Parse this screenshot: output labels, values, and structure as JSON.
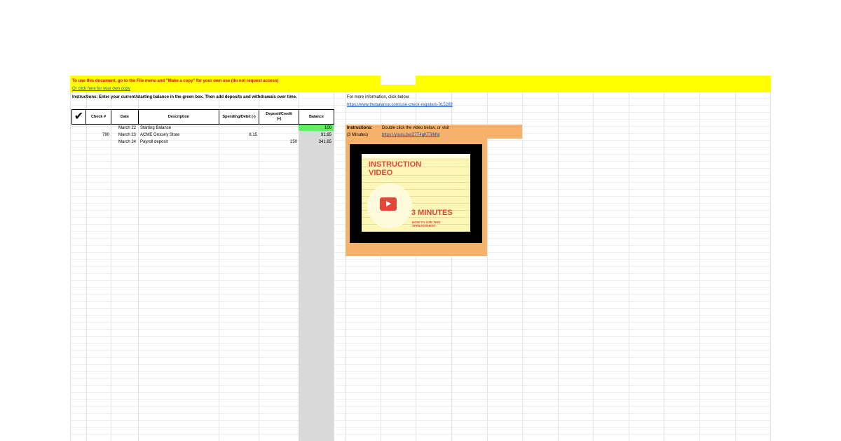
{
  "banner": {
    "copy_notice": "To use this document, go to the File menu and \"Make a copy\" for your own use (do not request access)",
    "copy_link": "Or click here for your own copy"
  },
  "instructions": "Instructions: Enter your current/starting balance in the green box. Then add deposits and withdrawals over time.",
  "more_info": {
    "label": "For more information, click below:",
    "url": "https://www.thebalance.com/use-check-registers-315289"
  },
  "register": {
    "headers": {
      "check_mark": "✔",
      "check_no": "Check #",
      "date": "Date",
      "description": "Description",
      "spending": "Spending/Debit (-)",
      "deposit": "Deposit/Credit (+)",
      "balance": "Balance"
    },
    "rows": [
      {
        "check_no": "",
        "date": "March 22",
        "description": "Starting Balance",
        "spending": "",
        "deposit": "",
        "balance": "100"
      },
      {
        "check_no": "790",
        "date": "March 23",
        "description": "ACME Grocery Store",
        "spending": "8.15",
        "deposit": "",
        "balance": "91.85"
      },
      {
        "check_no": "",
        "date": "March 24",
        "description": "Payroll deposit",
        "spending": "",
        "deposit": "250",
        "balance": "341.85"
      }
    ]
  },
  "video_box": {
    "label": "Instructions:",
    "sublabel": "(3 Minutes)",
    "text": "Double click the video below, or visit",
    "url": "https://youtu.be/Z7T4gKT3lMM",
    "thumb_title_1": "INSTRUCTION",
    "thumb_title_2": "VIDEO",
    "thumb_minutes": "3 MINUTES",
    "thumb_howto_1": "HOW TO USE THIS",
    "thumb_howto_2": "SPREADSHEET"
  },
  "colors": {
    "banner": "#ffff00",
    "starting_balance": "#5df25d",
    "balance_column": "#d9d9d9",
    "video_box": "#f6b26b",
    "thumbnail_accent": "#e0483a",
    "link": "#1155cc"
  }
}
